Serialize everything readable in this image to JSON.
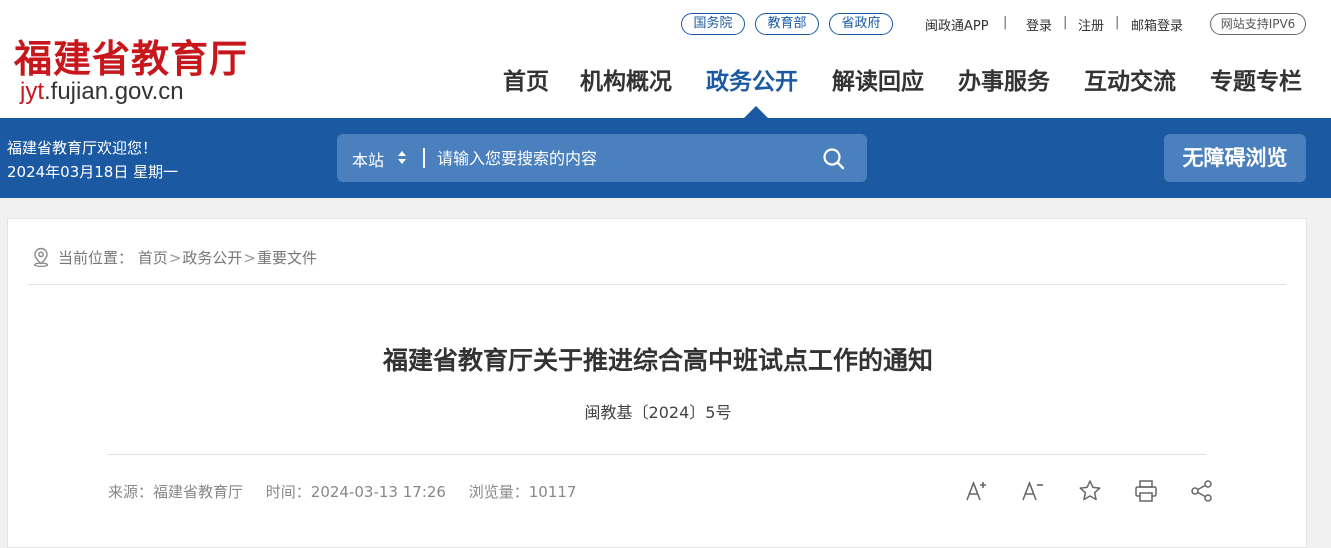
{
  "header": {
    "logo_cn": "福建省教育厅",
    "logo_en_accent": "jyt",
    "logo_en_rest": ".fujian.gov.cn",
    "top_pills": [
      "国务院",
      "教育部",
      "省政府"
    ],
    "top_links": [
      "闽政通APP",
      "登录",
      "注册",
      "邮箱登录"
    ],
    "separator": "|",
    "ipv6": "网站支持IPV6"
  },
  "nav": {
    "items": [
      "首页",
      "机构概况",
      "政务公开",
      "解读回应",
      "办事服务",
      "互动交流",
      "专题专栏"
    ],
    "active_index": 2
  },
  "bar": {
    "welcome": "福建省教育厅欢迎您！",
    "date": "2024年03月18日  星期一",
    "scope": "本站",
    "search_placeholder": "请输入您要搜索的内容",
    "accessibility": "无障碍浏览"
  },
  "breadcrumb": {
    "prefix": "当前位置：",
    "items": [
      "首页",
      "政务公开",
      "重要文件"
    ],
    "separator": ">"
  },
  "article": {
    "title": "福建省教育厅关于推进综合高中班试点工作的通知",
    "doc_number": "闽教基〔2024〕5号",
    "source": "来源：福建省教育厅",
    "time": "时间：2024-03-13 17:26",
    "views": "浏览量：10117"
  },
  "colors": {
    "brand_blue": "#1b5aa3",
    "logo_red": "#c8161d",
    "search_bg": "#4a80be"
  },
  "icons": [
    "location-icon",
    "search-icon",
    "font-increase-icon",
    "font-decrease-icon",
    "star-icon",
    "print-icon",
    "share-icon"
  ]
}
